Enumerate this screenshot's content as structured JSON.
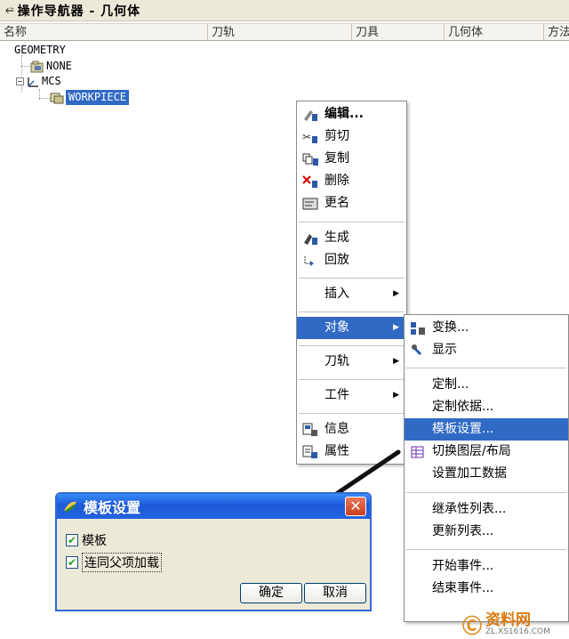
{
  "window": {
    "title": "操作导航器 - 几何体"
  },
  "columns": [
    "名称",
    "刀轨",
    "刀具",
    "几何体",
    "方法"
  ],
  "tree": {
    "root": "GEOMETRY",
    "items": [
      "NONE",
      "MCS",
      "WORKPIECE"
    ]
  },
  "context_menu": {
    "items": [
      "编辑...",
      "剪切",
      "复制",
      "删除",
      "更名",
      "生成",
      "回放",
      "插入",
      "对象",
      "刀轨",
      "工件",
      "信息",
      "属性"
    ]
  },
  "submenu": {
    "items": [
      "变换...",
      "显示",
      "定制...",
      "定制依据...",
      "模板设置...",
      "切换图层/布局",
      "设置加工数据",
      "继承性列表...",
      "更新列表...",
      "开始事件...",
      "结束事件..."
    ]
  },
  "dialog": {
    "title": "模板设置",
    "checkbox1": "模板",
    "checkbox2": "连同父项加载",
    "ok": "确定",
    "cancel": "取消"
  },
  "watermark": {
    "brand": "资料网",
    "url": "ZL.XS1616.COM"
  },
  "colors": {
    "highlight": "#316ac5",
    "dialog_title": "#2463de",
    "close": "#c8401e"
  }
}
